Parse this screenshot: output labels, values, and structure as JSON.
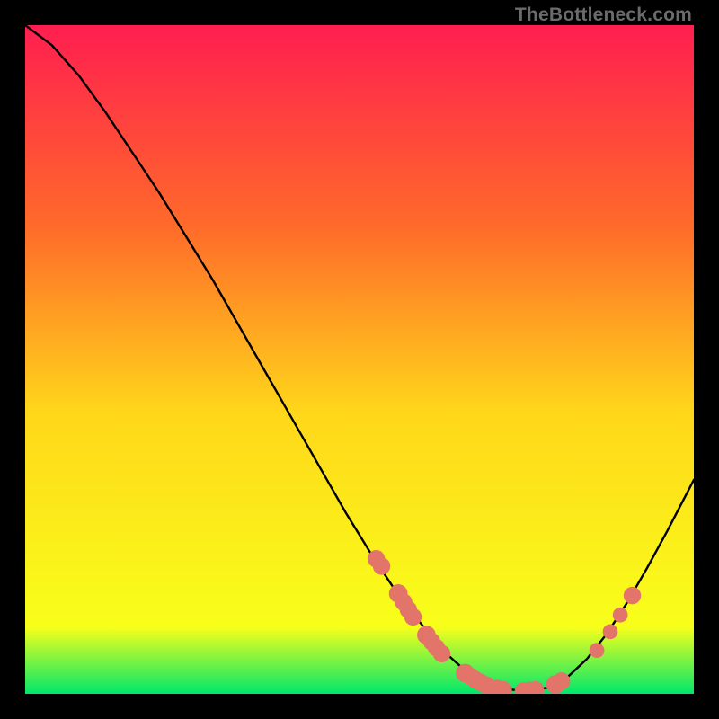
{
  "attribution": "TheBottleneck.com",
  "colors": {
    "gradient_top": "#ff1e50",
    "gradient_mid_upper": "#ff6a2a",
    "gradient_mid": "#ffd71a",
    "gradient_lower": "#f8ff1a",
    "gradient_bottom": "#00e76b",
    "curve": "#000000",
    "marker": "#e2746a"
  },
  "chart_data": {
    "type": "line",
    "title": "",
    "xlabel": "",
    "ylabel": "",
    "xlim": [
      0,
      100
    ],
    "ylim": [
      0,
      100
    ],
    "series": [
      {
        "name": "bottleneck-curve",
        "x": [
          0,
          4,
          8,
          12,
          16,
          20,
          24,
          28,
          32,
          36,
          40,
          44,
          48,
          52,
          56,
          60,
          63,
          66,
          69,
          72,
          75,
          78,
          81,
          84,
          87,
          90,
          93,
          96,
          100
        ],
        "y": [
          100,
          97,
          92.5,
          87,
          81,
          75,
          68.5,
          62,
          55,
          48,
          41,
          34,
          27,
          20.5,
          14.5,
          9.5,
          6,
          3.3,
          1.6,
          0.7,
          0.4,
          0.9,
          2.4,
          5.2,
          9,
          13.6,
          18.8,
          24.3,
          32
        ]
      }
    ],
    "markers": [
      {
        "x": 52.5,
        "y": 20.2,
        "r": 1.0
      },
      {
        "x": 53.3,
        "y": 19.1,
        "r": 1.0
      },
      {
        "x": 55.8,
        "y": 15.0,
        "r": 1.1
      },
      {
        "x": 56.6,
        "y": 13.7,
        "r": 1.0
      },
      {
        "x": 57.3,
        "y": 12.6,
        "r": 1.0
      },
      {
        "x": 58.0,
        "y": 11.5,
        "r": 1.0
      },
      {
        "x": 60.0,
        "y": 8.8,
        "r": 1.1
      },
      {
        "x": 60.8,
        "y": 7.8,
        "r": 1.0
      },
      {
        "x": 61.5,
        "y": 6.9,
        "r": 1.0
      },
      {
        "x": 62.3,
        "y": 6.0,
        "r": 1.0
      },
      {
        "x": 65.8,
        "y": 3.1,
        "r": 1.1
      },
      {
        "x": 66.6,
        "y": 2.6,
        "r": 1.0
      },
      {
        "x": 67.3,
        "y": 2.1,
        "r": 1.0
      },
      {
        "x": 68.1,
        "y": 1.7,
        "r": 1.0
      },
      {
        "x": 69.0,
        "y": 1.3,
        "r": 1.0
      },
      {
        "x": 70.6,
        "y": 0.8,
        "r": 1.0
      },
      {
        "x": 71.5,
        "y": 0.6,
        "r": 1.0
      },
      {
        "x": 74.5,
        "y": 0.4,
        "r": 1.0
      },
      {
        "x": 75.4,
        "y": 0.5,
        "r": 1.0
      },
      {
        "x": 76.3,
        "y": 0.6,
        "r": 1.0
      },
      {
        "x": 79.3,
        "y": 1.4,
        "r": 1.1
      },
      {
        "x": 80.2,
        "y": 1.9,
        "r": 1.0
      },
      {
        "x": 85.5,
        "y": 6.5,
        "r": 0.8
      },
      {
        "x": 87.5,
        "y": 9.3,
        "r": 0.8
      },
      {
        "x": 89.0,
        "y": 11.8,
        "r": 0.8
      },
      {
        "x": 90.8,
        "y": 14.7,
        "r": 1.0
      }
    ]
  }
}
